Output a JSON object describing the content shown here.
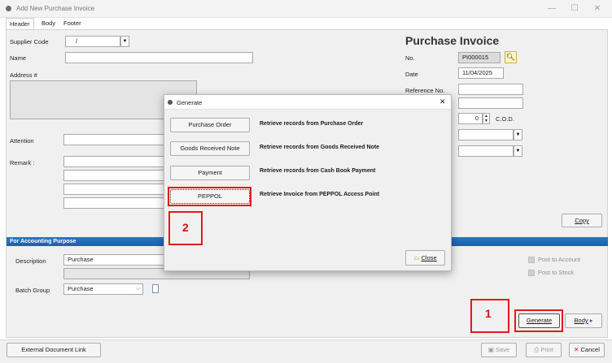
{
  "window": {
    "title": "Add New Purchase Invoice",
    "min_glyph": "—",
    "max_glyph": "☐",
    "close_glyph": "✕"
  },
  "tabs": [
    "Header",
    "Body",
    "Footer"
  ],
  "header": {
    "heading": "Purchase Invoice",
    "supplier_code_label": "Supplier Code",
    "supplier_code_value": "/",
    "name_label": "Name",
    "address_label": "Address #",
    "attention_label": "Attention",
    "remark_label": "Remark :",
    "no_label": "No.",
    "no_value": "PI000015",
    "date_label": "Date",
    "date_value": "11/04/2025",
    "reference_label": "Reference No.",
    "cod_value": "0",
    "cod_label": "C.O.D."
  },
  "accounting": {
    "section_title": "For Accounting Purpose",
    "description_label": "Description",
    "description_value": "Purchase",
    "batch_group_label": "Batch Group",
    "batch_group_value": "Purchase",
    "post_to_account": "Post to Account",
    "post_to_stock": "Post to Stock"
  },
  "buttons": {
    "copy": "Copy",
    "generate": "Generate",
    "body": "Body",
    "external_link": "External Document Link",
    "save": "Save",
    "print": "Print",
    "cancel": "Cancel"
  },
  "modal": {
    "title": "Generate",
    "close_x": "✕",
    "options": [
      {
        "label": "Purchase Order",
        "description": "Retrieve records from Purchase Order"
      },
      {
        "label": "Goods Received Note",
        "description": "Retrieve records from Goods Received Note"
      },
      {
        "label": "Payment",
        "description": "Retrieve records from Cash Book Payment"
      },
      {
        "label": "PEPPOL",
        "description": "Retrieve Invoice from PEPPOL Access Point"
      }
    ],
    "close_button": "Close"
  },
  "annotations": [
    "1",
    "2"
  ],
  "colors": {
    "annotation_red": "#e11b1b",
    "section_blue": "#1b5fb0"
  }
}
